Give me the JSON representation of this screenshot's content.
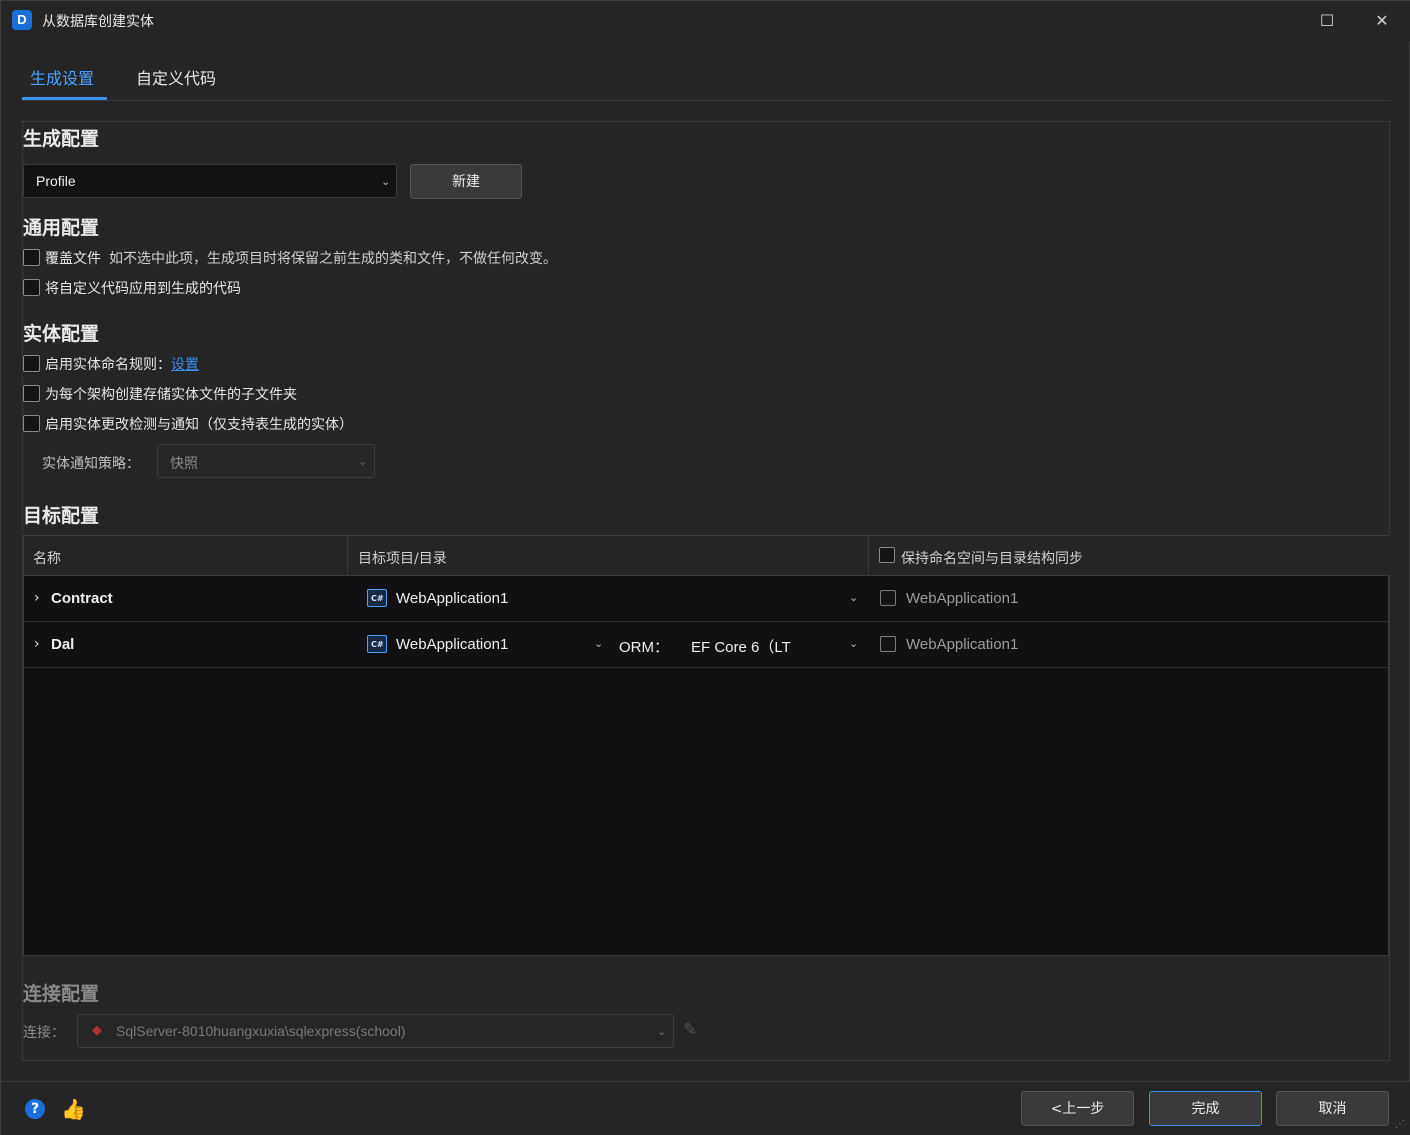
{
  "window": {
    "title": "从数据库创建实体",
    "icon_letter": "D",
    "maximize_glyph": "☐",
    "close_glyph": "✕"
  },
  "tabs": [
    {
      "label": "生成设置",
      "active": true
    },
    {
      "label": "自定义代码",
      "active": false
    }
  ],
  "generation": {
    "title": "生成配置",
    "profile_value": "Profile",
    "new_button": "新建"
  },
  "general": {
    "title": "通用配置",
    "overwrite_label": "覆盖文件",
    "overwrite_hint": "如不选中此项，生成项目时将保留之前生成的类和文件，不做任何改变。",
    "apply_custom_label": "将自定义代码应用到生成的代码"
  },
  "entity": {
    "title": "实体配置",
    "naming_rule_label": "启用实体命名规则：",
    "naming_rule_link": "设置",
    "subfolder_label": "为每个架构创建存储实体文件的子文件夹",
    "change_detect_label": "启用实体更改检测与通知（仅支持表生成的实体）",
    "strategy_label": "实体通知策略：",
    "strategy_value": "快照"
  },
  "target": {
    "title": "目标配置",
    "columns": {
      "name": "名称",
      "project": "目标项目/目录",
      "sync_ns": "保持命名空间与目录结构同步"
    },
    "rows": [
      {
        "name": "Contract",
        "project": "WebApplication1",
        "namespace": "WebApplication1",
        "orm_label": "",
        "orm_value": ""
      },
      {
        "name": "Dal",
        "project": "WebApplication1",
        "namespace": "WebApplication1",
        "orm_label": "ORM：",
        "orm_value": "EF Core 6（LT"
      }
    ],
    "cs_badge": "C#",
    "expander_glyph": "›"
  },
  "connection": {
    "title": "连接配置",
    "label": "连接：",
    "value": "SqlServer-8010huangxuxia\\sqlexpress(school)"
  },
  "footer": {
    "help_glyph": "?",
    "like_glyph": "👍",
    "prev_button": "<上一步",
    "finish_button": "完成",
    "cancel_button": "取消"
  }
}
